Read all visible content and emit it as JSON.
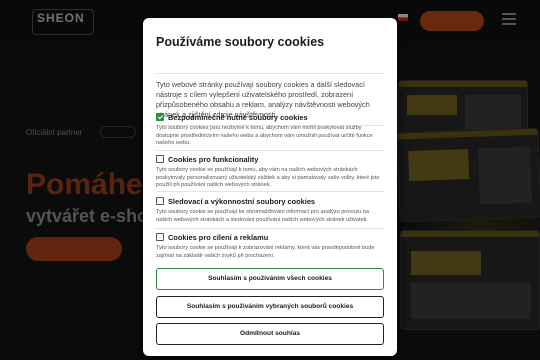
{
  "background": {
    "logo": {
      "line1": "SHEON",
      "line2": ""
    },
    "header_cta": "",
    "subtitle": "Oficiální partner",
    "headline": "Pomáhe",
    "subheadline": "vytvářet e-sho",
    "cta": ""
  },
  "dialog": {
    "title": "Používáme soubory cookies",
    "intro": "Tyto webové stránky používají soubory cookies a další sledovací nástroje s cílem vylepšení uživatelského prostředí, zobrazení přizpůsobeného obsahu a reklam, analýzy návštěvnosti webových stránek a zjištění zdroje návštěvnosti.",
    "options": [
      {
        "title": "Bezpodmínečně nutné soubory cookies",
        "checked": true,
        "description": "Tyto soubory cookies jsou nezbytné k tomu, abychom vám mohli poskytovat služby dostupné prostřednictvím našeho webu a abychom vám umožnili používat určité funkce našeho webu."
      },
      {
        "title": "Cookies pro funkcionality",
        "checked": false,
        "description": "Tyto soubory cookie se používají k tomu, aby vám na našich webových stránkách poskytovaly personalizovaný uživatelský zážitek a aby si pamatovaly vaše volby, které jste použili při používání našich webových stránek."
      },
      {
        "title": "Sledovací a výkonnostní soubory cookies",
        "checked": false,
        "description": "Tyto soubory cookie se používají ke shromažďování informací pro analýzu provozu na našich webových stránkách a sledování používání našich webových stránek uživateli."
      },
      {
        "title": "Cookies pro cílení a reklamu",
        "checked": false,
        "description": "Tyto soubory cookie se používají k zobrazování reklamy, která vás pravděpodobně bude zajímat na základě vašich zvyků při procházení."
      }
    ],
    "buttons": {
      "accept_all": "Souhlasím s používáním všech cookies",
      "accept_selected": "Souhlasím s používáním vybraných souborů cookies",
      "reject": "Odmítnout souhlas"
    }
  },
  "colors": {
    "accent_orange": "#c2491d",
    "accept_green": "#2f8a3a",
    "overlay": "rgba(0,0,0,0.45)"
  }
}
